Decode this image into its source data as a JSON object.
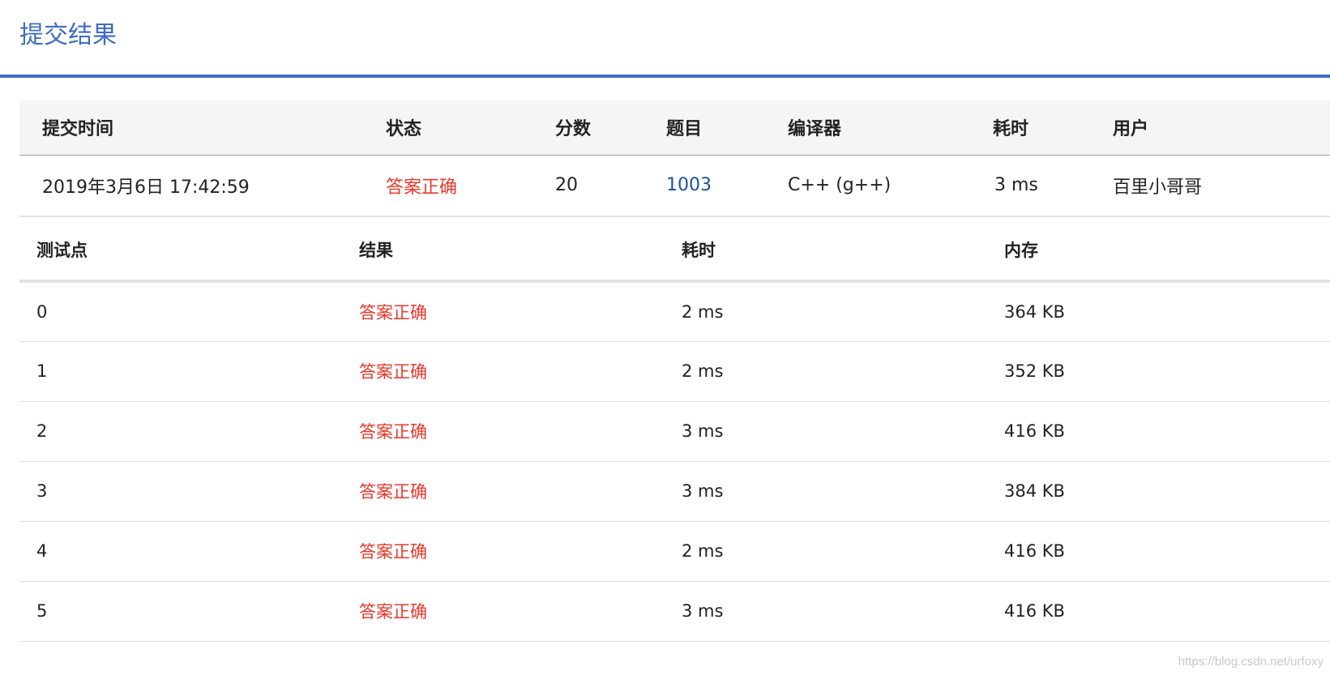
{
  "page": {
    "title": "提交结果"
  },
  "summary": {
    "headers": [
      "提交时间",
      "状态",
      "分数",
      "题目",
      "编译器",
      "耗时",
      "用户"
    ],
    "row": {
      "time": "2019年3月6日 17:42:59",
      "status": "答案正确",
      "score": "20",
      "problem": "1003",
      "compiler": "C++ (g++)",
      "duration": "3 ms",
      "user": "百里小哥哥"
    }
  },
  "cases": {
    "headers": [
      "测试点",
      "结果",
      "耗时",
      "内存"
    ],
    "rows": [
      {
        "id": "0",
        "result": "答案正确",
        "time": "2 ms",
        "memory": "364 KB"
      },
      {
        "id": "1",
        "result": "答案正确",
        "time": "2 ms",
        "memory": "352 KB"
      },
      {
        "id": "2",
        "result": "答案正确",
        "time": "3 ms",
        "memory": "416 KB"
      },
      {
        "id": "3",
        "result": "答案正确",
        "time": "3 ms",
        "memory": "384 KB"
      },
      {
        "id": "4",
        "result": "答案正确",
        "time": "2 ms",
        "memory": "416 KB"
      },
      {
        "id": "5",
        "result": "答案正确",
        "time": "3 ms",
        "memory": "416 KB"
      }
    ]
  },
  "watermark": "https://blog.csdn.net/urfoxy",
  "colors": {
    "accent": "#3d6cc3",
    "status_ok": "#e8392c",
    "link": "#1f4f9c"
  }
}
